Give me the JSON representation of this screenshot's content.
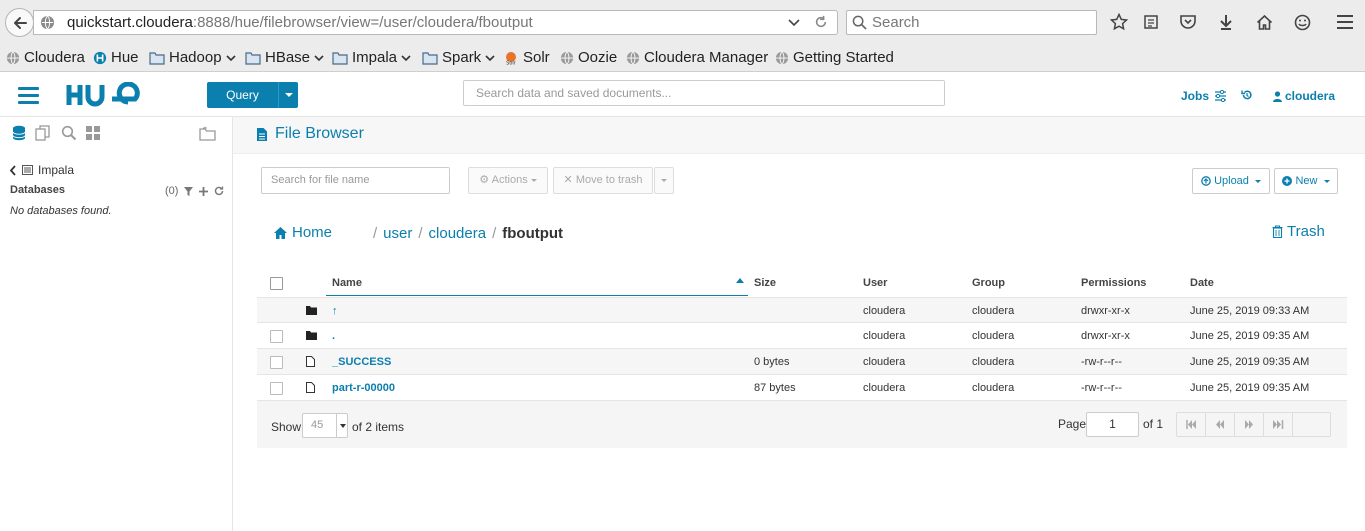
{
  "browser": {
    "url_host": "quickstart.cloudera",
    "url_rest": ":8888/hue/filebrowser/view=/user/cloudera/fboutput",
    "search_placeholder": "Search",
    "bookmarks": [
      {
        "label": "Cloudera",
        "icon": "globe-icon",
        "dropdown": false
      },
      {
        "label": "Hue",
        "icon": "hue-icon",
        "dropdown": false
      },
      {
        "label": "Hadoop",
        "icon": "folder-icon",
        "dropdown": true
      },
      {
        "label": "HBase",
        "icon": "folder-icon",
        "dropdown": true
      },
      {
        "label": "Impala",
        "icon": "folder-icon",
        "dropdown": true
      },
      {
        "label": "Spark",
        "icon": "folder-icon",
        "dropdown": true
      },
      {
        "label": "Solr",
        "icon": "solr-icon",
        "dropdown": false
      },
      {
        "label": "Oozie",
        "icon": "globe-icon",
        "dropdown": false
      },
      {
        "label": "Cloudera Manager",
        "icon": "globe-icon",
        "dropdown": false
      },
      {
        "label": "Getting Started",
        "icon": "globe-icon",
        "dropdown": false
      }
    ]
  },
  "hue": {
    "query_label": "Query",
    "search_placeholder": "Search data and saved documents...",
    "jobs_label": "Jobs",
    "user_label": "cloudera",
    "accent": "#0b7fad"
  },
  "left_panel": {
    "crumb": "Impala",
    "databases_label": "Databases",
    "count": "(0)",
    "empty_text": "No databases found."
  },
  "file_browser": {
    "title": "File Browser",
    "search_placeholder": "Search for file name",
    "actions_label": "Actions",
    "move_to_trash_label": "Move to trash",
    "upload_label": "Upload",
    "new_label": "New",
    "home_label": "Home",
    "breadcrumb": [
      "user",
      "cloudera",
      "fboutput"
    ],
    "trash_label": "Trash",
    "columns": {
      "name": "Name",
      "size": "Size",
      "user": "User",
      "group": "Group",
      "permissions": "Permissions",
      "date": "Date"
    },
    "rows": [
      {
        "type": "folder",
        "name": "↑",
        "size": "",
        "user": "cloudera",
        "group": "cloudera",
        "permissions": "drwxr-xr-x",
        "date": "June 25, 2019 09:33 AM",
        "checkbox": false
      },
      {
        "type": "folder",
        "name": ".",
        "size": "",
        "user": "cloudera",
        "group": "cloudera",
        "permissions": "drwxr-xr-x",
        "date": "June 25, 2019 09:35 AM",
        "checkbox": true
      },
      {
        "type": "file",
        "name": "_SUCCESS",
        "size": "0 bytes",
        "user": "cloudera",
        "group": "cloudera",
        "permissions": "-rw-r--r--",
        "date": "June 25, 2019 09:35 AM",
        "checkbox": true
      },
      {
        "type": "file",
        "name": "part-r-00000",
        "size": "87 bytes",
        "user": "cloudera",
        "group": "cloudera",
        "permissions": "-rw-r--r--",
        "date": "June 25, 2019 09:35 AM",
        "checkbox": true
      }
    ],
    "pager": {
      "show_label": "Show",
      "page_size": "45",
      "items_label": "of 2 items",
      "page_label": "Page",
      "page_value": "1",
      "of_label": "of 1"
    }
  }
}
